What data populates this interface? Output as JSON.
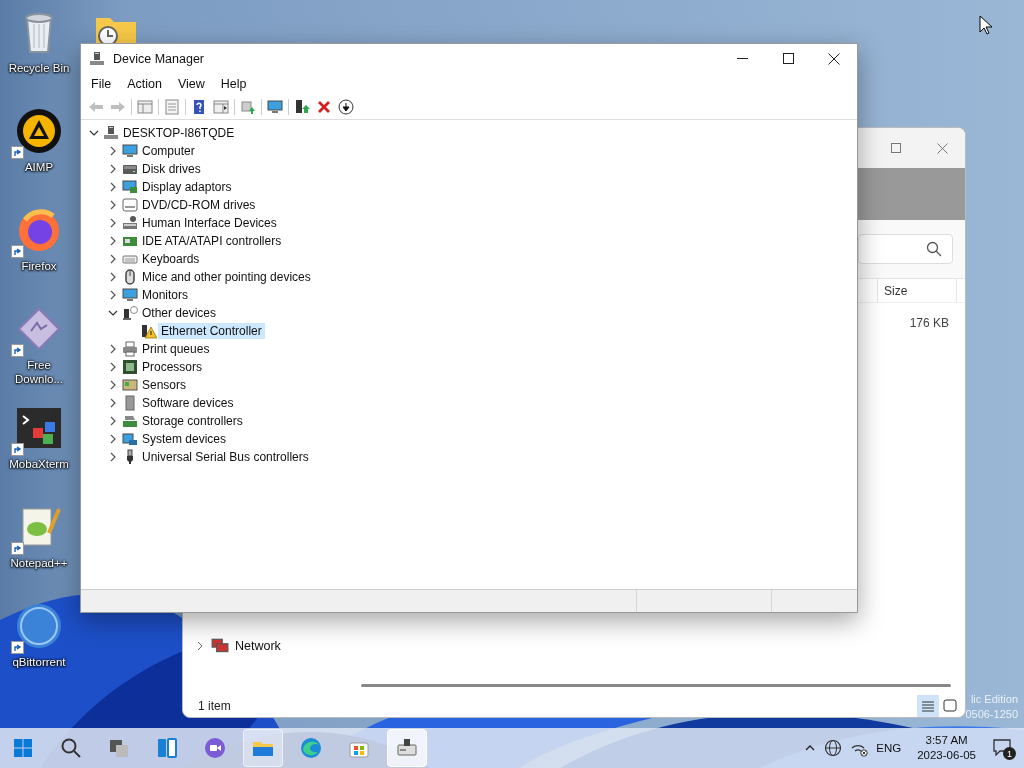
{
  "desktop_icons": [
    {
      "kind": "recycle-bin",
      "label": "Recycle Bin",
      "shortcut": false
    },
    {
      "kind": "aimp",
      "label": "AIMP",
      "shortcut": true
    },
    {
      "kind": "firefox",
      "label": "Firefox",
      "shortcut": true
    },
    {
      "kind": "download-manager",
      "label": "Free Downlo...",
      "shortcut": true
    },
    {
      "kind": "terminal",
      "label": "MobaXterm",
      "shortcut": true
    },
    {
      "kind": "notepad",
      "label": "Notepad++",
      "shortcut": true
    },
    {
      "kind": "torrent",
      "label": "qBittorrent",
      "shortcut": true
    }
  ],
  "explorer_window": {
    "columns": [
      {
        "label": "Size"
      }
    ],
    "rows": [
      {
        "size": "176 KB"
      }
    ],
    "nav_items": [
      {
        "kind": "network",
        "label": "Network",
        "expanded": false
      }
    ],
    "status": "1 item",
    "view_buttons": [
      {
        "kind": "details",
        "selected": true
      },
      {
        "kind": "tiles",
        "selected": false
      }
    ]
  },
  "edition_text": [
    "lic Edition",
    "0506-1250"
  ],
  "device_manager": {
    "title": "Device Manager",
    "menu": [
      "File",
      "Action",
      "View",
      "Help"
    ],
    "toolbar": [
      [
        {
          "kind": "back",
          "disabled": true
        },
        {
          "kind": "forward",
          "disabled": true
        }
      ],
      [
        {
          "kind": "console-tree",
          "disabled": false
        }
      ],
      [
        {
          "kind": "properties",
          "disabled": false
        }
      ],
      [
        {
          "kind": "help",
          "disabled": false
        },
        {
          "kind": "action-pane",
          "disabled": false
        }
      ],
      [
        {
          "kind": "scan",
          "disabled": false
        }
      ],
      [
        {
          "kind": "monitor",
          "disabled": false
        }
      ],
      [
        {
          "kind": "update",
          "disabled": false
        },
        {
          "kind": "uninstall",
          "disabled": false
        },
        {
          "kind": "disable",
          "disabled": false
        }
      ]
    ],
    "tree": {
      "kind": "pc",
      "label": "DESKTOP-I86TQDE",
      "expanded": true,
      "selected": false,
      "children": [
        {
          "kind": "computer",
          "label": "Computer",
          "expanded": false,
          "selected": false
        },
        {
          "kind": "disk",
          "label": "Disk drives",
          "expanded": false,
          "selected": false
        },
        {
          "kind": "display",
          "label": "Display adaptors",
          "expanded": false,
          "selected": false
        },
        {
          "kind": "dvd",
          "label": "DVD/CD-ROM drives",
          "expanded": false,
          "selected": false
        },
        {
          "kind": "hid",
          "label": "Human Interface Devices",
          "expanded": false,
          "selected": false
        },
        {
          "kind": "ide",
          "label": "IDE ATA/ATAPI controllers",
          "expanded": false,
          "selected": false
        },
        {
          "kind": "keyboard",
          "label": "Keyboards",
          "expanded": false,
          "selected": false
        },
        {
          "kind": "mouse",
          "label": "Mice and other pointing devices",
          "expanded": false,
          "selected": false
        },
        {
          "kind": "monitor",
          "label": "Monitors",
          "expanded": false,
          "selected": false
        },
        {
          "kind": "other",
          "label": "Other devices",
          "expanded": true,
          "selected": false,
          "children": [
            {
              "kind": "device-warning",
              "label": "Ethernet Controller",
              "selected": true
            }
          ]
        },
        {
          "kind": "print",
          "label": "Print queues",
          "expanded": false,
          "selected": false
        },
        {
          "kind": "processor",
          "label": "Processors",
          "expanded": false,
          "selected": false
        },
        {
          "kind": "sensor",
          "label": "Sensors",
          "expanded": false,
          "selected": false
        },
        {
          "kind": "software",
          "label": "Software devices",
          "expanded": false,
          "selected": false
        },
        {
          "kind": "storage",
          "label": "Storage controllers",
          "expanded": false,
          "selected": false
        },
        {
          "kind": "system",
          "label": "System devices",
          "expanded": false,
          "selected": false
        },
        {
          "kind": "usb",
          "label": "Universal Serial Bus controllers",
          "expanded": false,
          "selected": false
        }
      ]
    }
  },
  "taskbar": {
    "apps": [
      {
        "kind": "start",
        "running": false,
        "focused": false
      },
      {
        "kind": "search",
        "running": false,
        "focused": false
      },
      {
        "kind": "task-view",
        "running": false,
        "focused": false
      },
      {
        "kind": "widgets",
        "running": false,
        "focused": false
      },
      {
        "kind": "chat",
        "running": false,
        "focused": false
      },
      {
        "kind": "explorer",
        "running": true,
        "focused": false
      },
      {
        "kind": "edge",
        "running": false,
        "focused": false
      },
      {
        "kind": "store",
        "running": false,
        "focused": false
      },
      {
        "kind": "device-manager",
        "running": true,
        "focused": true
      }
    ],
    "language": "ENG",
    "time": "3:57 AM",
    "date": "2023-06-05",
    "notifications": "1"
  }
}
